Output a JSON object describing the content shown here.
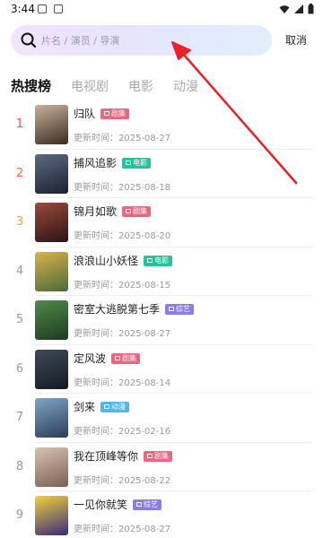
{
  "status": {
    "time": "3:44"
  },
  "search": {
    "placeholder": "片名 / 演员 / 导演",
    "cancel_label": "取消"
  },
  "tabs": [
    {
      "label": "热搜榜",
      "active": true
    },
    {
      "label": "电视剧",
      "active": false
    },
    {
      "label": "电影",
      "active": false
    },
    {
      "label": "动漫",
      "active": false
    }
  ],
  "items": [
    {
      "rank": "1",
      "title": "归队",
      "badge": "剧集",
      "badge_color": "#e9687f",
      "updated": "更新时间：2025-08-27",
      "poster_colors": [
        "#c9b199",
        "#3a2b22"
      ]
    },
    {
      "rank": "2",
      "title": "捕风追影",
      "badge": "电影",
      "badge_color": "#27c29a",
      "updated": "更新时间：2025-08-18",
      "poster_colors": [
        "#5b6a82",
        "#1c2230"
      ]
    },
    {
      "rank": "3",
      "title": "锦月如歌",
      "badge": "剧集",
      "badge_color": "#e9687f",
      "updated": "更新时间：2025-08-20",
      "poster_colors": [
        "#9c4a3c",
        "#2a1416"
      ]
    },
    {
      "rank": "4",
      "title": "浪浪山小妖怪",
      "badge": "电影",
      "badge_color": "#27c29a",
      "updated": "更新时间：2025-08-15",
      "poster_colors": [
        "#d8b24a",
        "#4d6a3a"
      ]
    },
    {
      "rank": "5",
      "title": "密室大逃脱第七季",
      "badge": "综艺",
      "badge_color": "#8a7cf0",
      "updated": "更新时间：2025-08-27",
      "poster_colors": [
        "#4f8a4a",
        "#1e3a20"
      ]
    },
    {
      "rank": "6",
      "title": "定风波",
      "badge": "剧集",
      "badge_color": "#e9687f",
      "updated": "更新时间：2025-08-14",
      "poster_colors": [
        "#3f4a56",
        "#141a22"
      ]
    },
    {
      "rank": "7",
      "title": "剑来",
      "badge": "动漫",
      "badge_color": "#4fb6ef",
      "updated": "更新时间：2025-02-16",
      "poster_colors": [
        "#7fa4c4",
        "#2c3e58"
      ]
    },
    {
      "rank": "8",
      "title": "我在顶峰等你",
      "badge": "剧集",
      "badge_color": "#e9687f",
      "updated": "更新时间：2025-08-22",
      "poster_colors": [
        "#d7c2b4",
        "#7d5e53"
      ]
    },
    {
      "rank": "9",
      "title": "一见你就笑",
      "badge": "综艺",
      "badge_color": "#8a7cf0",
      "updated": "更新时间：2025-08-27",
      "poster_colors": [
        "#f0d23a",
        "#3a2a7a"
      ]
    }
  ]
}
